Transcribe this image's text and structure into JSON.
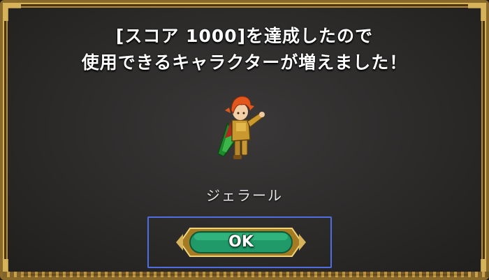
{
  "dialog": {
    "message_line1": "[スコア 1000]を達成したので",
    "message_line2": "使用できるキャラクターが増えました！"
  },
  "character": {
    "name": "ジェラール",
    "sprite_icon": "character-sprite-icon"
  },
  "buttons": {
    "ok_label": "OK"
  },
  "colors": {
    "frame_gold": "#d6b25a",
    "button_green": "#1f9a68",
    "focus_blue": "#4f6fe0",
    "dialog_bg": "#2b2a29"
  }
}
